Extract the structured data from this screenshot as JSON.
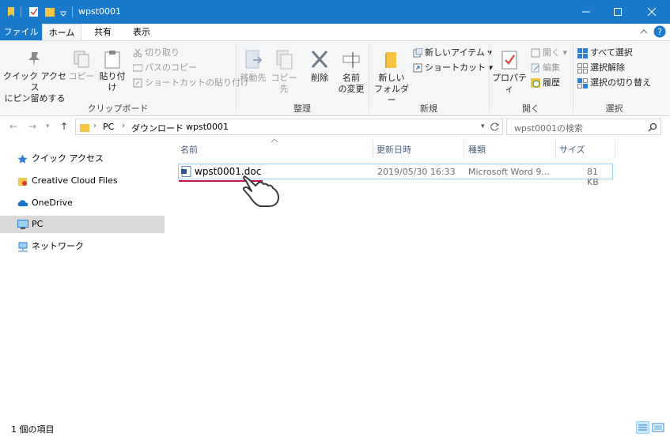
{
  "window": {
    "title": "wpst0001",
    "accent": "#1979ca",
    "controls": [
      "minimize-icon",
      "maximize-icon",
      "close-icon"
    ]
  },
  "tabs": {
    "file": "ファイル",
    "home": "ホーム",
    "share": "共有",
    "view": "表示"
  },
  "ribbon": {
    "clipboard": {
      "group": "クリップボード",
      "pin_line1": "クイック アクセス",
      "pin_line2": "にピン留めする",
      "copy": "コピー",
      "paste": "貼り付け",
      "cut": "切り取り",
      "copy_path": "パスのコピー",
      "paste_shortcut": "ショートカットの貼り付け"
    },
    "organize": {
      "group": "整理",
      "move_to": "移動先",
      "copy_to": "コピー先",
      "delete": "削除",
      "rename_line1": "名前",
      "rename_line2": "の変更"
    },
    "new": {
      "group": "新規",
      "new_folder_line1": "新しい",
      "new_folder_line2": "フォルダー",
      "new_item": "新しいアイテム",
      "easy_access": "ショートカット"
    },
    "open": {
      "group": "開く",
      "properties": "プロパティ",
      "open": "開く",
      "edit": "編集",
      "history": "履歴"
    },
    "select": {
      "group": "選択",
      "select_all": "すべて選択",
      "select_none": "選択解除",
      "invert": "選択の切り替え"
    }
  },
  "address": {
    "crumbs": [
      "PC",
      "ダウンロード",
      "wpst0001"
    ],
    "search_placeholder": "wpst0001の検索"
  },
  "nav": {
    "items": [
      {
        "label": "クイック アクセス",
        "icon": "star-icon"
      },
      {
        "label": "Creative Cloud Files",
        "icon": "folder-icon"
      },
      {
        "label": "OneDrive",
        "icon": "cloud-icon"
      },
      {
        "label": "PC",
        "icon": "computer-icon"
      },
      {
        "label": "ネットワーク",
        "icon": "network-icon"
      }
    ]
  },
  "filelist": {
    "columns": [
      "名前",
      "更新日時",
      "種類",
      "サイズ"
    ],
    "rows": [
      {
        "name": "wpst0001.doc",
        "modified": "2019/05/30 16:33",
        "type": "Microsoft Word 9...",
        "size": "81 KB"
      }
    ]
  },
  "status": {
    "text": "1 個の項目"
  }
}
